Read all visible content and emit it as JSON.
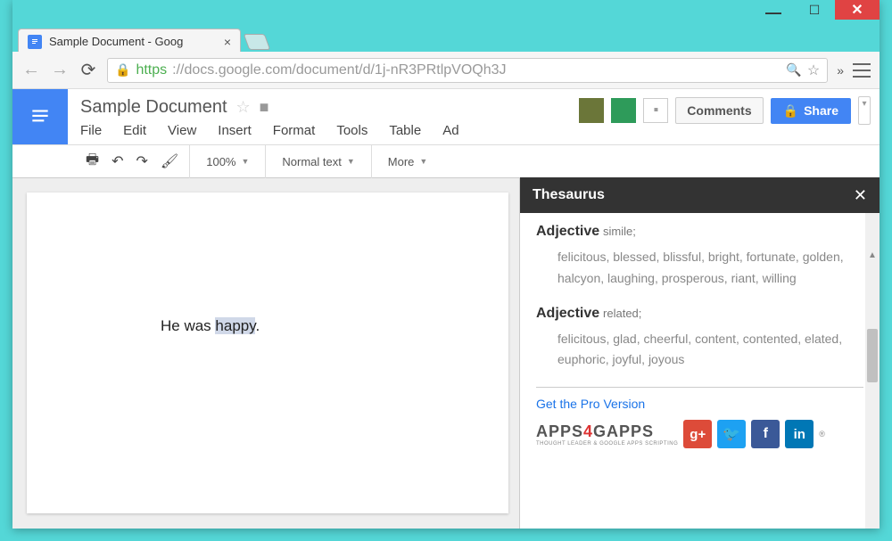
{
  "browser": {
    "tab_title": "Sample Document - Goog",
    "url_protocol": "https",
    "url_host_path": "://docs.google.com/document/d/1j-nR3PRtlpVOQh3J"
  },
  "docs": {
    "title": "Sample Document",
    "menus": [
      "File",
      "Edit",
      "View",
      "Insert",
      "Format",
      "Tools",
      "Table",
      "Ad"
    ],
    "comments_label": "Comments",
    "share_label": "Share"
  },
  "toolbar": {
    "zoom": "100%",
    "style": "Normal text",
    "more": "More"
  },
  "document": {
    "text_before": "He was ",
    "highlighted": "happy",
    "text_after": "."
  },
  "sidebar": {
    "title": "Thesaurus",
    "entries": [
      {
        "pos": "Adjective",
        "subtype": "simile;",
        "words": "felicitous, blessed, blissful, bright, fortunate, golden, halcyon, laughing, prosperous, riant, willing"
      },
      {
        "pos": "Adjective",
        "subtype": "related;",
        "words": "felicitous, glad, cheerful, content, contented, elated, euphoric, joyful, joyous"
      }
    ],
    "pro_link": "Get the Pro Version",
    "brand_a": "APPS",
    "brand_4": "4",
    "brand_b": "GAPPS",
    "brand_sub": "THOUGHT LEADER & GOOGLE APPS SCRIPTING"
  }
}
